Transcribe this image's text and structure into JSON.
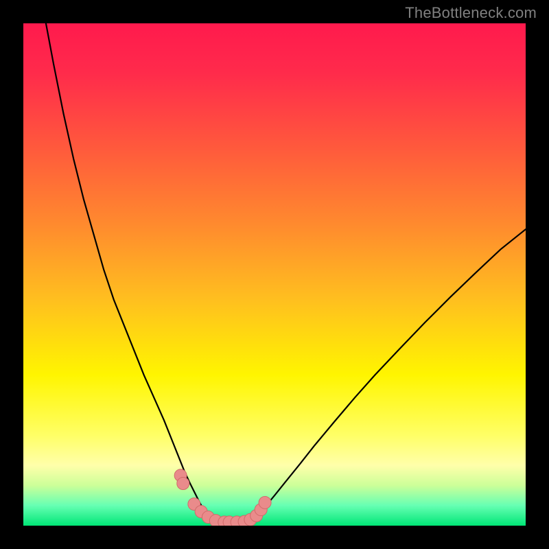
{
  "watermark": "TheBottleneck.com",
  "colors": {
    "frame": "#000000",
    "gradient_stops": [
      {
        "offset": 0.0,
        "color": "#ff1a4d"
      },
      {
        "offset": 0.1,
        "color": "#ff2b4b"
      },
      {
        "offset": 0.25,
        "color": "#ff5a3c"
      },
      {
        "offset": 0.4,
        "color": "#ff8a2e"
      },
      {
        "offset": 0.55,
        "color": "#ffbf1f"
      },
      {
        "offset": 0.7,
        "color": "#fff500"
      },
      {
        "offset": 0.82,
        "color": "#ffff66"
      },
      {
        "offset": 0.88,
        "color": "#ffffaa"
      },
      {
        "offset": 0.92,
        "color": "#ccff99"
      },
      {
        "offset": 0.96,
        "color": "#66ffb3"
      },
      {
        "offset": 1.0,
        "color": "#00e676"
      }
    ],
    "curve": "#000000",
    "marker_fill": "#e98b8b",
    "marker_stroke": "#d16a6a"
  },
  "chart_data": {
    "type": "line",
    "title": "",
    "xlabel": "",
    "ylabel": "",
    "xlim": [
      0,
      100
    ],
    "ylim": [
      0,
      100
    ],
    "grid": false,
    "legend": false,
    "series": [
      {
        "name": "left-branch",
        "x": [
          4.5,
          6,
          8,
          10,
          12,
          14,
          16,
          18,
          20,
          22,
          24,
          26,
          28,
          29,
          30,
          31,
          32,
          33,
          34,
          35,
          36,
          37,
          38
        ],
        "y": [
          100,
          92,
          82,
          73,
          65,
          58,
          51,
          45,
          40,
          35,
          30,
          25.5,
          21,
          18.5,
          16,
          13.5,
          11,
          8.8,
          6.8,
          4.8,
          3.0,
          1.5,
          0.5
        ]
      },
      {
        "name": "floor",
        "x": [
          38,
          39,
          40,
          41,
          42,
          43,
          44,
          45
        ],
        "y": [
          0.5,
          0.3,
          0.2,
          0.2,
          0.2,
          0.3,
          0.4,
          0.6
        ]
      },
      {
        "name": "right-branch",
        "x": [
          45,
          46,
          47,
          48,
          50,
          52,
          55,
          58,
          62,
          66,
          70,
          75,
          80,
          85,
          90,
          95,
          100
        ],
        "y": [
          0.6,
          1.2,
          2.3,
          3.6,
          6.0,
          8.5,
          12.2,
          16.0,
          20.8,
          25.5,
          30.0,
          35.3,
          40.5,
          45.5,
          50.3,
          55.0,
          59.0
        ]
      }
    ],
    "markers": {
      "name": "highlight-points",
      "x": [
        31.3,
        31.8,
        34.0,
        35.4,
        36.8,
        38.3,
        40.0,
        41.0,
        42.5,
        44.0,
        45.2,
        46.4,
        47.3,
        48.1
      ],
      "y": [
        10.0,
        8.4,
        4.3,
        2.8,
        1.7,
        1.0,
        0.7,
        0.7,
        0.7,
        0.8,
        1.2,
        2.0,
        3.2,
        4.6
      ]
    }
  }
}
